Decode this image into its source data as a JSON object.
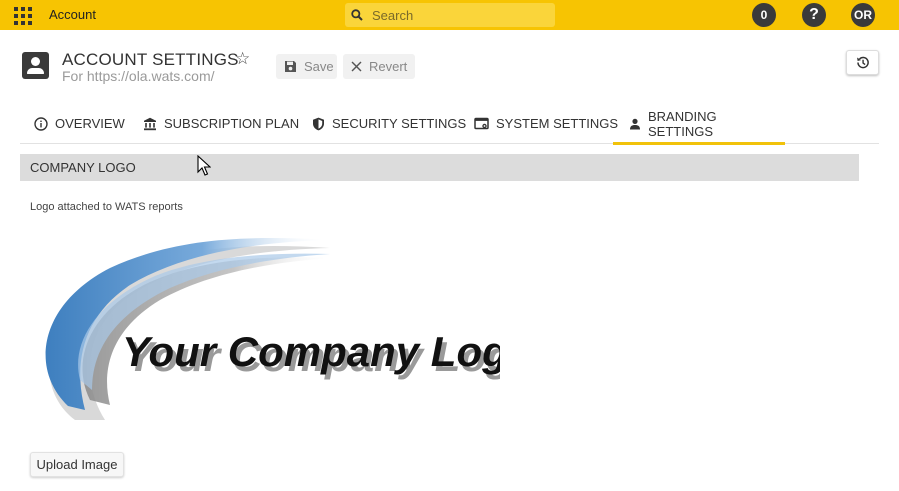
{
  "topbar": {
    "app_title": "Account",
    "search_placeholder": "Search",
    "notification_count": "0",
    "help_label": "?",
    "user_initials": "OR"
  },
  "header": {
    "title": "ACCOUNT SETTINGS",
    "subtitle": "For https://ola.wats.com/",
    "save_label": "Save",
    "revert_label": "Revert"
  },
  "tabs": [
    {
      "label": "OVERVIEW",
      "icon": "info-icon",
      "active": false
    },
    {
      "label": "SUBSCRIPTION PLAN",
      "icon": "bank-icon",
      "active": false
    },
    {
      "label": "SECURITY SETTINGS",
      "icon": "shield-icon",
      "active": false
    },
    {
      "label": "SYSTEM SETTINGS",
      "icon": "monitor-settings-icon",
      "active": false
    },
    {
      "label": "BRANDING SETTINGS",
      "icon": "person-icon",
      "active": true
    }
  ],
  "section": {
    "title": "COMPANY LOGO",
    "description": "Logo attached to WATS reports",
    "logo_text": "Your Company Logo",
    "upload_label": "Upload Image"
  },
  "colors": {
    "topbar": "#f7c402",
    "search_bg": "#fad53a",
    "active_tab_underline": "#f1c20a",
    "section_header_bg": "#dcdcdc",
    "logo_swoosh": "#4f8fc6"
  }
}
